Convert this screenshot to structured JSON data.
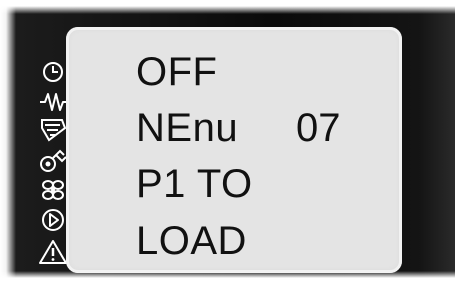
{
  "display": {
    "line1": "OFF",
    "line2": "NEnu",
    "line2_value": "07",
    "line3": "P1 TO",
    "line4": "LOAD"
  },
  "status_icons": [
    "clock-icon",
    "heater-wave-icon",
    "defrost-icon",
    "compressor-icon",
    "fan-icon",
    "play-icon",
    "alarm-icon"
  ],
  "colors": {
    "bezel": "#0d0d0d",
    "lcd_background": "#e4e4e4",
    "lcd_text": "#111111",
    "icon_stroke": "#ffffff"
  }
}
